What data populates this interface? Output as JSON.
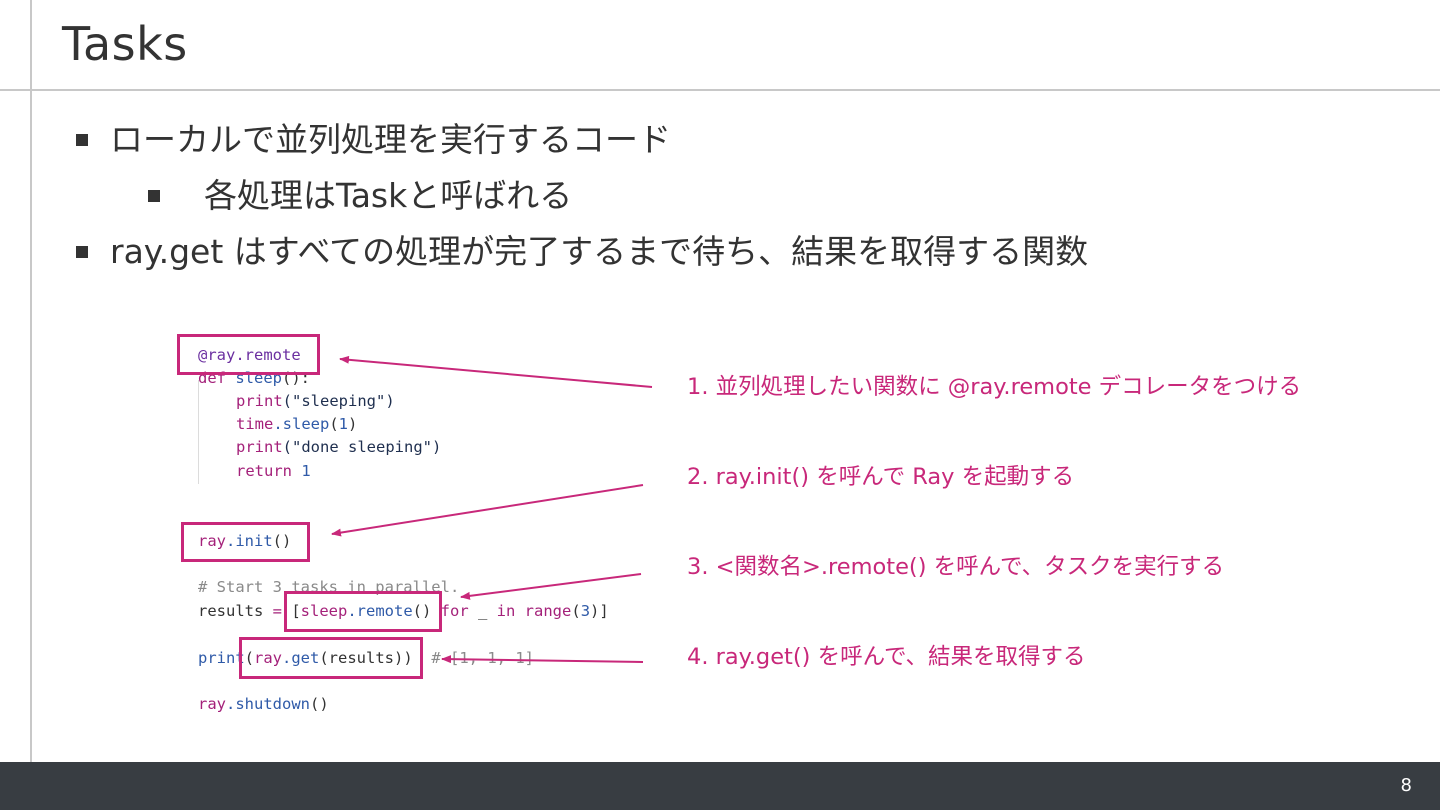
{
  "slide": {
    "title": "Tasks",
    "page_number": "8"
  },
  "bullets": [
    "ローカルで並列処理を実行するコード",
    "各処理はTaskと呼ばれる",
    "ray.get はすべての処理が完了するまで待ち、結果を取得する関数"
  ],
  "code": {
    "l1": "@ray.remote",
    "l2_def": "def",
    "l2_name": "sleep",
    "l2_rest": "():",
    "l3_print": "print",
    "l3_arg": "(\"sleeping\")",
    "l4_time": "time",
    "l4_sleep": ".sleep",
    "l4_p1": "(",
    "l4_num": "1",
    "l4_p2": ")",
    "l5_print": "print",
    "l5_arg": "(\"done sleeping\")",
    "l6_return": "return",
    "l6_num": "1",
    "l7_ray": "ray",
    "l7_init": ".init",
    "l7_paren": "()",
    "l8_comment": "# Start 3 tasks in parallel.",
    "l9_results": "results ",
    "l9_eq": "=",
    "l9_open": " [",
    "l9_sleep": "sleep",
    "l9_remote": ".remote",
    "l9_call": "() ",
    "l9_for": "for",
    "l9_us": " _ ",
    "l9_in": "in",
    "l9_range": " range",
    "l9_p1": "(",
    "l9_num": "3",
    "l9_p2": ")]",
    "l10_print": "print",
    "l10_p1": "(",
    "l10_ray": "ray",
    "l10_get": ".get",
    "l10_rest": "(results))",
    "l10_comment": "# [1, 1, 1]",
    "l11_ray": "ray",
    "l11_shutdown": ".shutdown",
    "l11_paren": "()"
  },
  "annotations": [
    "1. 並列処理したい関数に @ray.remote デコレータをつける",
    "2. ray.init() を呼んで Ray を起動する",
    "3. <関数名>.remote() を呼んで、タスクを実行する",
    "4. ray.get() を呼んで、結果を取得する"
  ],
  "colors": {
    "accent": "#c8287a",
    "text": "#333333",
    "footer": "#383d42",
    "rule": "#c8c8c8"
  }
}
